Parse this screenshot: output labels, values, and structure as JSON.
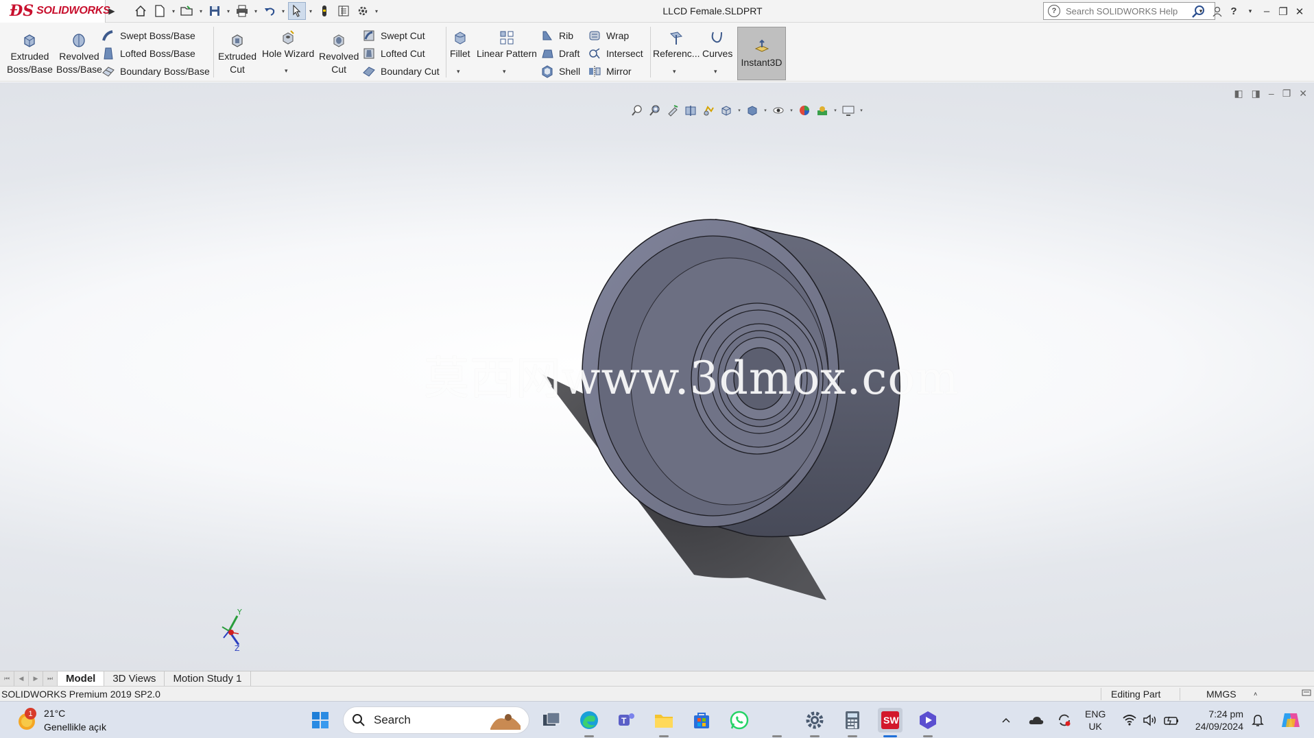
{
  "titlebar": {
    "brand": "SOLIDWORKS",
    "document_title": "LLCD Female.SLDPRT",
    "help_search_placeholder": "Search SOLIDWORKS Help"
  },
  "ribbon": {
    "extruded_boss_1": "Extruded",
    "extruded_boss_2": "Boss/Base",
    "revolved_boss_1": "Revolved",
    "revolved_boss_2": "Boss/Base",
    "swept_boss": "Swept Boss/Base",
    "lofted_boss": "Lofted Boss/Base",
    "boundary_boss": "Boundary Boss/Base",
    "extruded_cut_1": "Extruded",
    "extruded_cut_2": "Cut",
    "hole_wizard": "Hole Wizard",
    "revolved_cut_1": "Revolved",
    "revolved_cut_2": "Cut",
    "swept_cut": "Swept Cut",
    "lofted_cut": "Lofted Cut",
    "boundary_cut": "Boundary Cut",
    "fillet": "Fillet",
    "linear_pattern": "Linear Pattern",
    "rib": "Rib",
    "draft": "Draft",
    "shell": "Shell",
    "wrap": "Wrap",
    "intersect": "Intersect",
    "mirror": "Mirror",
    "reference": "Referenc...",
    "curves": "Curves",
    "instant3d": "Instant3D"
  },
  "viewport": {
    "watermark": "莫西网www.3dmox.com",
    "triad_y": "Y",
    "triad_z": "Z"
  },
  "tabs": [
    "Model",
    "3D Views",
    "Motion Study 1"
  ],
  "status": {
    "product": "SOLIDWORKS Premium 2019 SP2.0",
    "mode": "Editing Part",
    "units": "MMGS"
  },
  "taskbar": {
    "weather_temp": "21°C",
    "weather_desc": "Genellikle açık",
    "weather_badge": "1",
    "search_label": "Search",
    "lang_1": "ENG",
    "lang_2": "UK",
    "time": "7:24 pm",
    "date": "24/09/2024"
  },
  "colors": {
    "brand_red": "#c8102e",
    "part_body": "#5d6070",
    "part_face": "#7c7f91",
    "taskbar": "#dde3ee"
  }
}
